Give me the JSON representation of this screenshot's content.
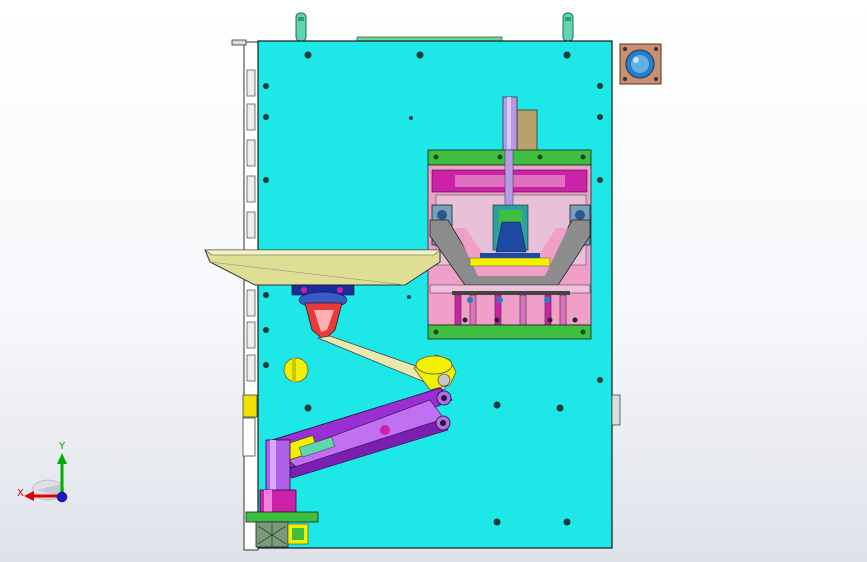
{
  "view": {
    "background_top": "#ffffff",
    "background_bottom": "#dfe2ea",
    "panel_color": "#1ee7e7",
    "accent_colors": {
      "green": "#3fbf3f",
      "magenta": "#cc22aa",
      "pink": "#f0a0c8",
      "purple": "#9a2fd4",
      "khaki": "#dede94",
      "yellow": "#f0f000",
      "steel": "#8c8c8c",
      "lavender": "#b79ae6"
    }
  },
  "triad": {
    "x_label": "X",
    "y_label": "Y",
    "x_color": "#dd0000",
    "y_color": "#00b000",
    "z_color": "#0000cc"
  }
}
